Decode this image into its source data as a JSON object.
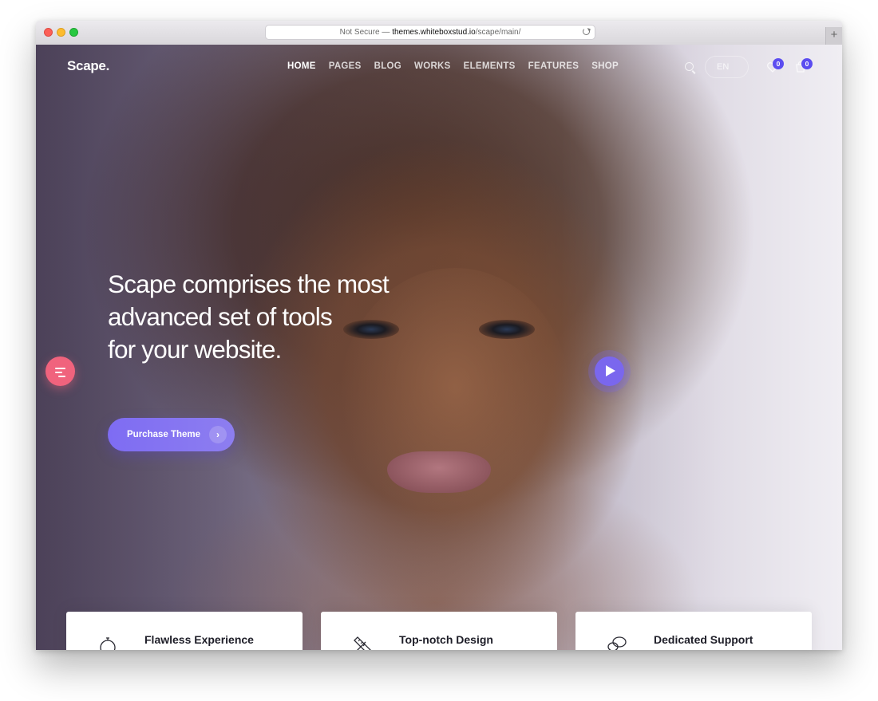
{
  "browser": {
    "security_label": "Not Secure",
    "separator": " — ",
    "host": "themes.whiteboxstud.io",
    "path": "/scape/main/",
    "new_tab_symbol": "+"
  },
  "site": {
    "logo": "Scape.",
    "nav": [
      {
        "label": "HOME",
        "active": true
      },
      {
        "label": "PAGES",
        "active": false
      },
      {
        "label": "BLOG",
        "active": false
      },
      {
        "label": "WORKS",
        "active": false
      },
      {
        "label": "ELEMENTS",
        "active": false
      },
      {
        "label": "FEATURES",
        "active": false
      },
      {
        "label": "SHOP",
        "active": false
      }
    ],
    "language": "EN",
    "wishlist_count": "0",
    "cart_count": "0"
  },
  "hero": {
    "headline_lines": [
      "Scape comprises the most",
      "advanced set of tools",
      "for your website."
    ],
    "cta_label": "Purchase Theme",
    "cta_arrow": "›"
  },
  "features": [
    {
      "title": "Flawless Experience",
      "icon": "stopwatch-icon"
    },
    {
      "title": "Top-notch Design",
      "icon": "ruler-pencil-icon"
    },
    {
      "title": "Dedicated Support",
      "icon": "chat-bubbles-icon"
    }
  ],
  "colors": {
    "accent_purple": "#7e6cf3",
    "badge_blue": "#5b4cf0",
    "side_button_pink": "#f0637d"
  }
}
